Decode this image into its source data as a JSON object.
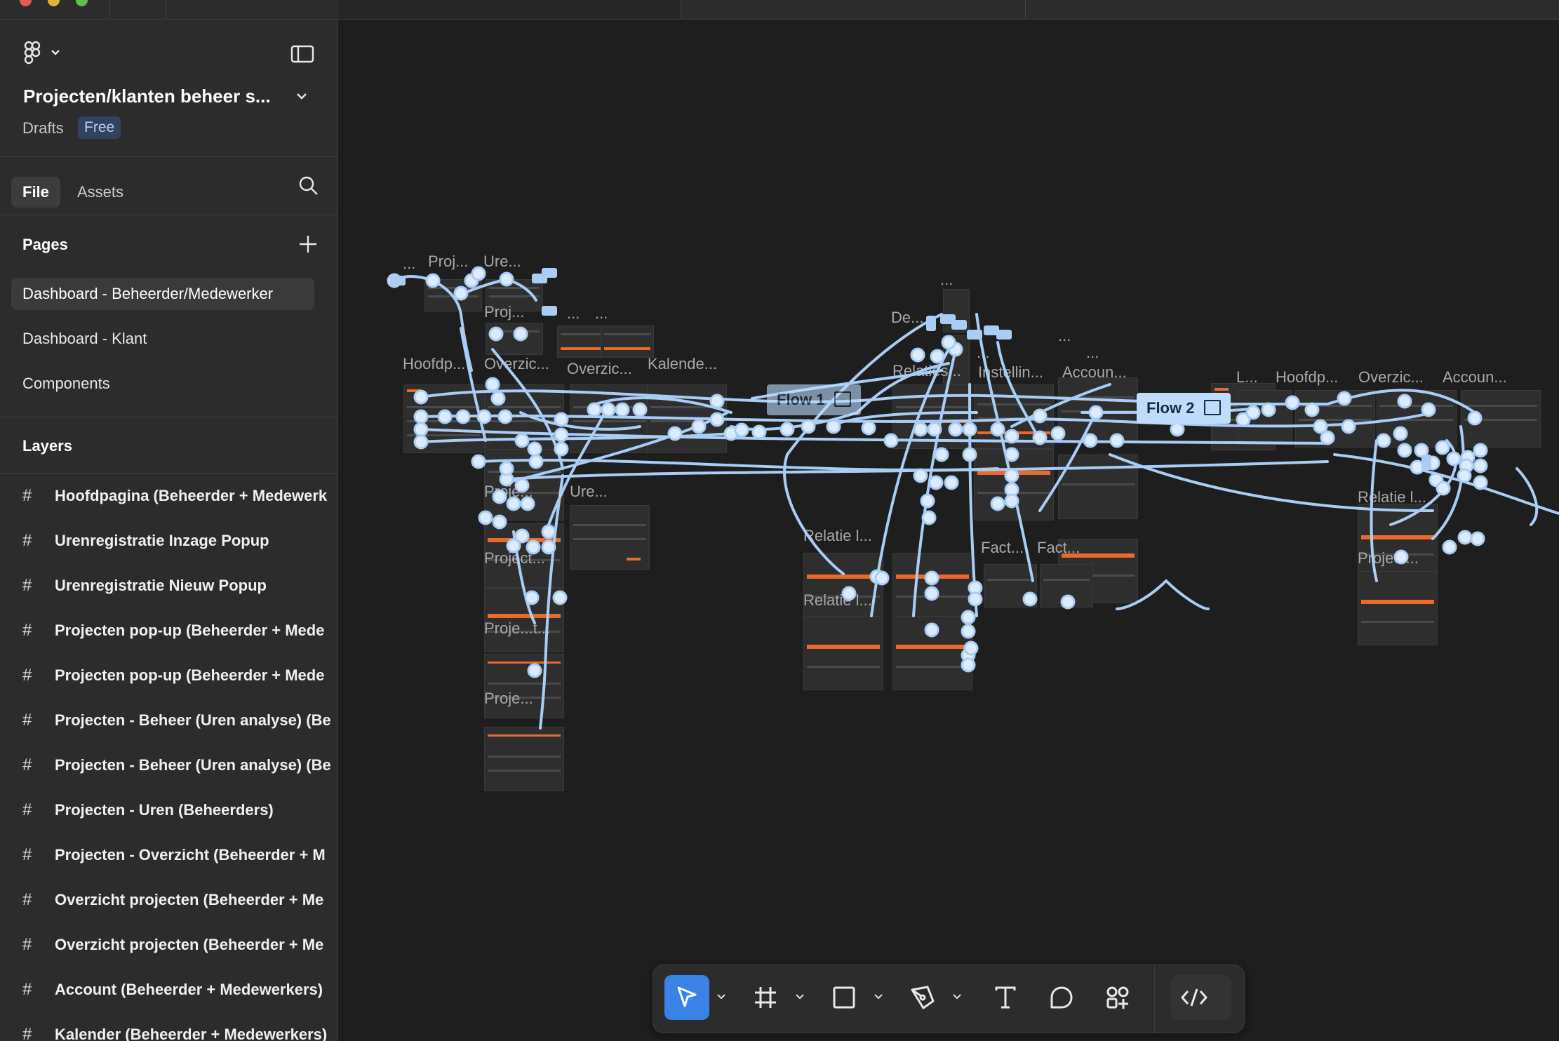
{
  "file": {
    "title": "Projecten/klanten beheer s...",
    "location": "Drafts",
    "plan_badge": "Free"
  },
  "panel_tabs": {
    "file": "File",
    "assets": "Assets"
  },
  "pages": {
    "heading": "Pages",
    "items": [
      {
        "label": "Dashboard - Beheerder/Medewerker",
        "selected": true
      },
      {
        "label": "Dashboard - Klant",
        "selected": false
      },
      {
        "label": "Components",
        "selected": false
      }
    ]
  },
  "layers": {
    "heading": "Layers",
    "items": [
      "Hoofdpagina (Beheerder + Medewerk",
      "Urenregistratie Inzage Popup",
      "Urenregistratie Nieuw Popup",
      "Projecten pop-up (Beheerder + Mede",
      "Projecten pop-up (Beheerder + Mede",
      "Projecten - Beheer (Uren analyse) (Be",
      "Projecten - Beheer (Uren analyse) (Be",
      "Projecten - Uren (Beheerders)",
      "Projecten - Overzicht (Beheerder + M",
      "Overzicht projecten (Beheerder + Me",
      "Overzicht projecten (Beheerder + Me",
      "Account (Beheerder + Medewerkers)",
      "Kalender (Beheerder + Medewerkers)"
    ]
  },
  "canvas": {
    "frame_labels": [
      "...",
      "Proj...",
      "Ure...",
      "Proj...",
      "...",
      "...",
      "Hoofdp...",
      "Overzic...",
      "Overzic...",
      "Kalende...",
      "Proje...",
      "Ure...",
      "Project...",
      "Proje...t...",
      "Proje...",
      "...",
      "De...",
      "...",
      "Relaties...",
      "Instellin...",
      "...",
      "...",
      "Accoun...",
      "Relatie l...",
      "Relatie l...",
      "Fact...",
      "Fact...",
      "L...",
      "Hoofdp...",
      "Overzic...",
      "Accoun...",
      "Relatie l...",
      "Project..."
    ],
    "flows": [
      {
        "label": "Flow 1"
      },
      {
        "label": "Flow 2"
      }
    ]
  },
  "toolbar": {
    "tools": [
      "move-tool",
      "frame-tool",
      "shape-tool",
      "pen-tool",
      "text-tool",
      "comment-tool",
      "actions-tool"
    ],
    "active_tool": "move-tool",
    "dev_mode": "dev-mode-toggle"
  },
  "colors": {
    "canvas_bg": "#1e1e1e",
    "panel_bg": "#2c2c2c",
    "prototype_connection": "#a9cdf5",
    "accent": "#3b82e6",
    "frame_accent": "#e96a2c"
  }
}
